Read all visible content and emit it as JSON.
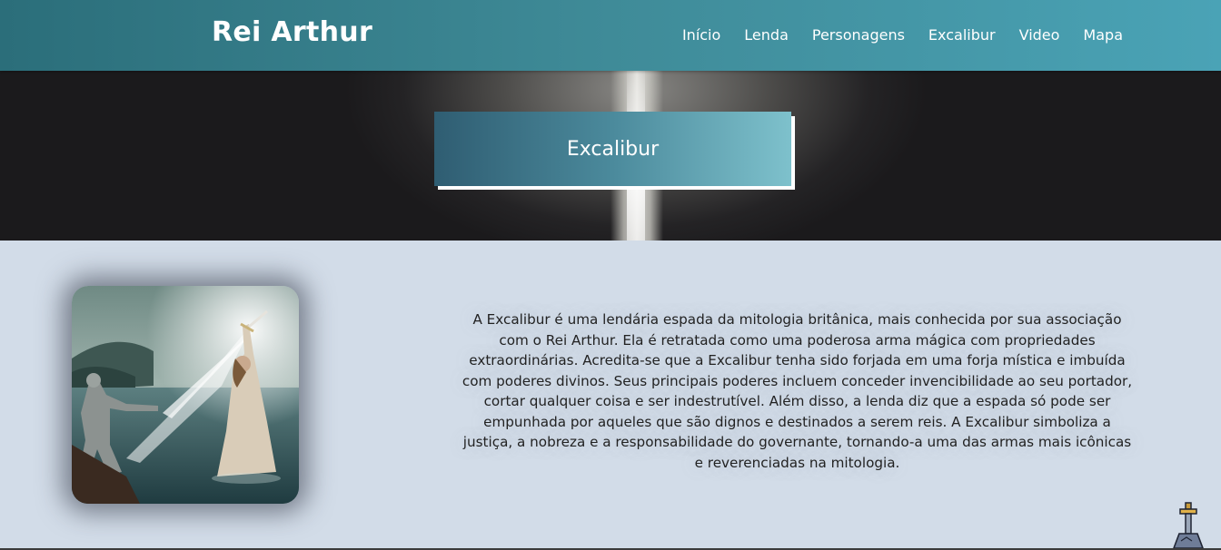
{
  "header": {
    "logo": "Rei Arthur",
    "nav": [
      "Início",
      "Lenda",
      "Personagens",
      "Excalibur",
      "Video",
      "Mapa"
    ]
  },
  "hero": {
    "title": "Excalibur"
  },
  "content": {
    "paragraph": "A Excalibur é uma lendária espada da mitologia britânica, mais conhecida por sua associação com o Rei Arthur. Ela é retratada como uma poderosa arma mágica com propriedades extraordinárias. Acredita-se que a Excalibur tenha sido forjada em uma forja mística e imbuída com poderes divinos. Seus principais poderes incluem conceder invencibilidade ao seu portador, cortar qualquer coisa e ser indestrutível. Além disso, a lenda diz que a espada só pode ser empunhada por aqueles que são dignos e destinados a serem reis. A Excalibur simboliza a justiça, a nobreza e a responsabilidade do governante, tornando-a uma das armas mais icônicas e reverenciadas na mitologia."
  },
  "icons": {
    "scroll_top": "sword-in-stone-icon"
  },
  "colors": {
    "header_start": "#2b6e7a",
    "header_end": "#4aa3b6",
    "page_bg": "#d2dce8",
    "title_box_start": "#2f5d72",
    "title_box_end": "#7ec1cc"
  }
}
